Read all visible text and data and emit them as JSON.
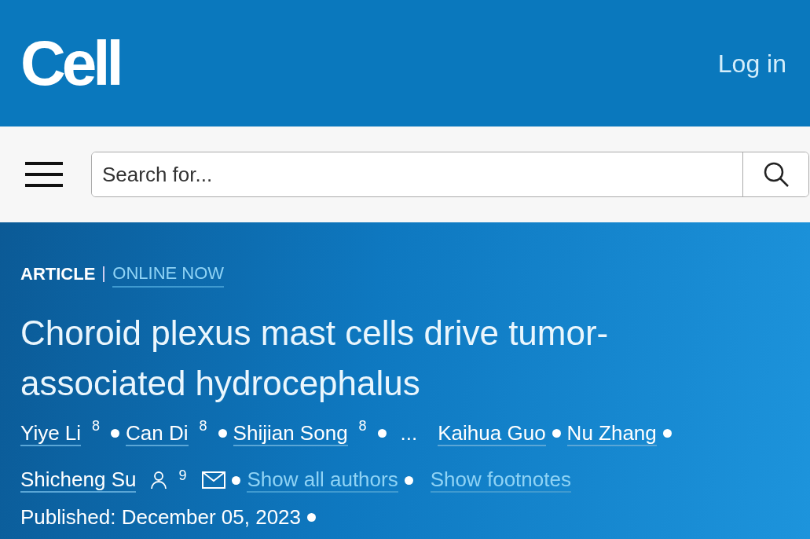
{
  "header": {
    "logo": "Cell",
    "login": "Log in"
  },
  "search": {
    "placeholder": "Search for..."
  },
  "article": {
    "type": "ARTICLE",
    "status": "ONLINE NOW",
    "title": "Choroid plexus mast cells drive tumor-associated hydrocephalus",
    "authors": [
      {
        "kind": "author",
        "name": "Yiye Li",
        "footnote": "8"
      },
      {
        "kind": "author",
        "name": "Can Di",
        "footnote": "8"
      },
      {
        "kind": "author",
        "name": "Shijian Song",
        "footnote": "8"
      },
      {
        "kind": "ellipsis",
        "name": "..."
      },
      {
        "kind": "author",
        "name": "Kaihua Guo"
      },
      {
        "kind": "author",
        "name": "Nu Zhang"
      },
      {
        "kind": "corresponding-author",
        "name": "Shicheng Su",
        "footnote": "9"
      }
    ],
    "links": [
      "Show all authors",
      "Show footnotes"
    ],
    "published": "Published: December 05, 2023"
  }
}
